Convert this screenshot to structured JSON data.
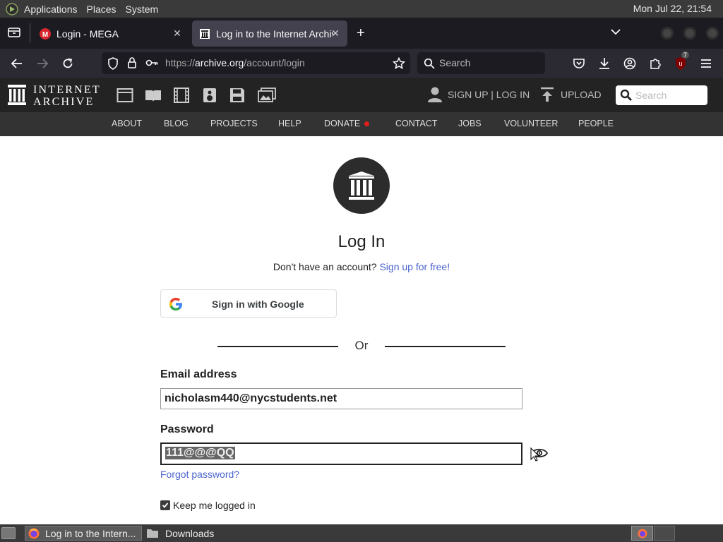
{
  "top_panel": {
    "menus": [
      "Applications",
      "Places",
      "System"
    ],
    "clock": "Mon Jul 22, 21:54"
  },
  "browser": {
    "tabs": [
      {
        "title": "Login - MEGA",
        "active": false
      },
      {
        "title": "Log in to the Internet Archive",
        "active": true
      }
    ],
    "url_prefix": "https://",
    "url_domain": "archive.org",
    "url_path": "/account/login",
    "search_placeholder": "Search",
    "extension_badge": "7"
  },
  "ia_header": {
    "logo_line1": "INTERNET",
    "logo_line2": "ARCHIVE",
    "auth_text": "SIGN UP | LOG IN",
    "upload_text": "UPLOAD",
    "search_placeholder": "Search",
    "nav": [
      "ABOUT",
      "BLOG",
      "PROJECTS",
      "HELP",
      "DONATE",
      "CONTACT",
      "JOBS",
      "VOLUNTEER",
      "PEOPLE"
    ]
  },
  "login": {
    "title": "Log In",
    "no_account": "Don't have an account?",
    "signup_link": "Sign up for free!",
    "google_button": "Sign in with Google",
    "or_text": "Or",
    "email_label": "Email address",
    "email_value": "nicholasm440@nycstudents.net",
    "password_label": "Password",
    "password_value": "111@@@QQ",
    "forgot_link": "Forgot password?",
    "keep_logged_in": "Keep me logged in",
    "keep_logged_in_checked": true
  },
  "taskbar": {
    "items": [
      "Log in to the Intern...",
      "Downloads"
    ]
  },
  "colors": {
    "link": "#4b64cf",
    "ia_header": "#232323",
    "ia_subnav": "#333333",
    "donate_dot": "#e0201b"
  }
}
